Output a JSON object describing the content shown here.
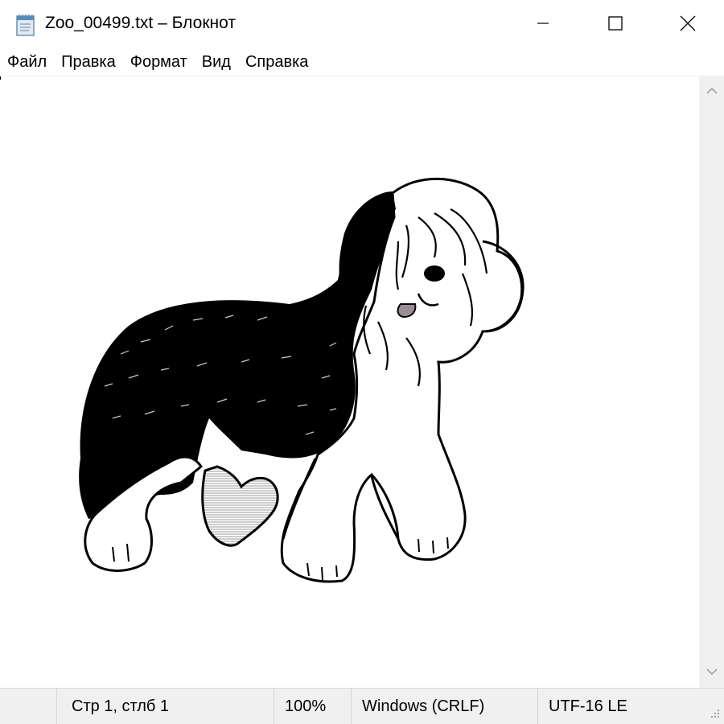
{
  "window": {
    "title": "Zoo_00499.txt – Блокнот",
    "icon": "notepad-icon",
    "controls": {
      "minimize": "minimize-icon",
      "maximize": "maximize-icon",
      "close": "close-icon"
    }
  },
  "menu": {
    "items": [
      "Файл",
      "Правка",
      "Формат",
      "Вид",
      "Справка"
    ]
  },
  "editor": {
    "content_description_icon": "ascii-art-dog"
  },
  "status": {
    "position": "Стр 1, стлб 1",
    "zoom": "100%",
    "line_ending": "Windows (CRLF)",
    "encoding": "UTF-16 LE"
  },
  "colors": {
    "chrome": "#f0f0f0",
    "border": "#d7d7d7",
    "tongue": "#9b8d95",
    "ear_shading": "#d9d9d9"
  }
}
